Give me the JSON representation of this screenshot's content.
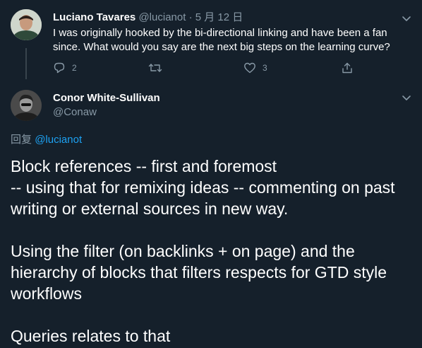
{
  "tweet1": {
    "author_name": "Luciano Tavares",
    "handle": "@lucianot",
    "separator": "·",
    "date": "5 月 12 日",
    "text": "I was originally hooked by the bi-directional linking and have been a fan since. What would you say are the next big steps on the learning curve?",
    "reply_count": "2",
    "retweet_count": "",
    "like_count": "3"
  },
  "tweet2": {
    "author_name": "Conor White-Sullivan",
    "handle": "@Conaw",
    "reply_prefix": "回复",
    "reply_to": "@lucianot",
    "lines": [
      "Block references -- first and foremost",
      "-- using that for remixing ideas -- commenting on past writing or external sources in new way.",
      "Using the filter (on backlinks + on page) and the hierarchy of blocks that filters respects for GTD style workflows",
      "Queries relates to that"
    ]
  },
  "icons": {
    "reply": "reply-icon",
    "retweet": "retweet-icon",
    "like": "heart-icon",
    "share": "share-icon",
    "menu": "chevron-down-icon"
  },
  "colors": {
    "background": "#15202b",
    "text": "#ffffff",
    "secondary": "#8899a6",
    "accent": "#1da1f2",
    "thread_line": "#38444d"
  }
}
